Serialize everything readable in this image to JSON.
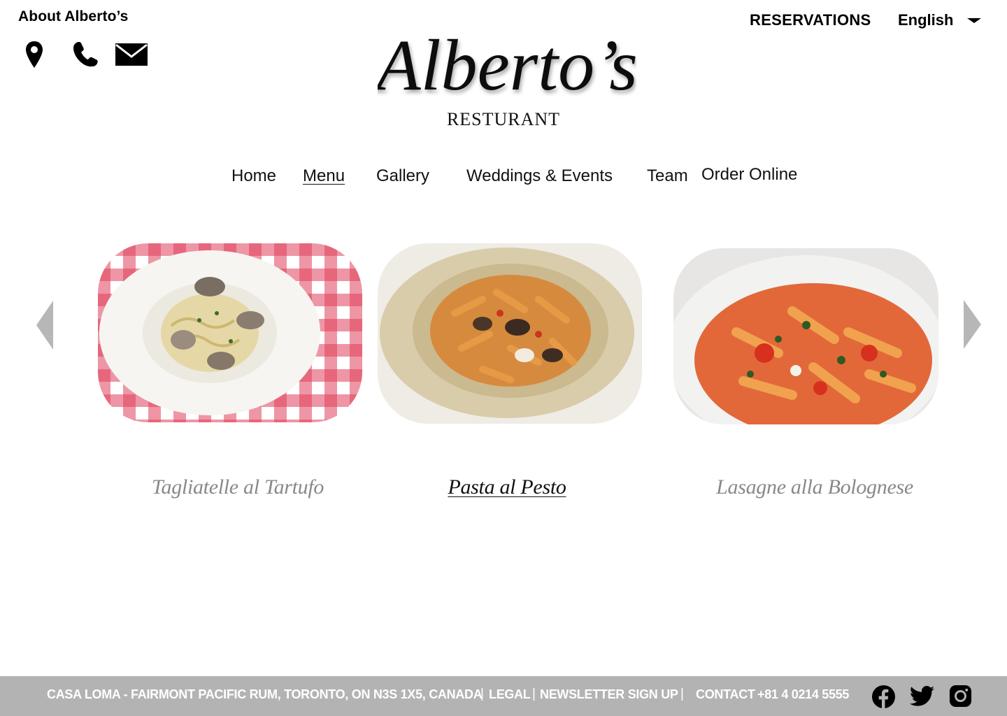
{
  "header": {
    "about_label": "About Alberto’s",
    "reservations_label": "RESERVATIONS",
    "language_label": "English",
    "logo_text": "Alberto’s",
    "logo_subtitle": "RESTURANT"
  },
  "contact_icons": [
    "location-pin-icon",
    "phone-icon",
    "email-icon"
  ],
  "nav": {
    "items": [
      {
        "label": "Home"
      },
      {
        "label": "Menu",
        "active": true
      },
      {
        "label": "Gallery"
      },
      {
        "label": "Weddings & Events"
      },
      {
        "label": "Team"
      },
      {
        "label": "Order Online"
      }
    ]
  },
  "carousel": {
    "dishes": [
      {
        "name": "Tagliatelle al Tartufo",
        "active": false
      },
      {
        "name": "Pasta al Pesto",
        "active": true
      },
      {
        "name": "Lasagne alla Bolognese",
        "active": false
      }
    ],
    "prev_icon": "chevron-left-icon",
    "next_icon": "chevron-right-icon"
  },
  "footer": {
    "address": "CASA LOMA - FAIRMONT PACIFIC RUM, TORONTO, ON N3S 1X5, CANADA",
    "legal": "LEGAL",
    "newsletter": "NEWSLETTER SIGN UP",
    "contact_label": "CONTACT",
    "phone": "+81 4 0214 5555",
    "separator": "|",
    "social": [
      "facebook-icon",
      "twitter-icon",
      "instagram-icon"
    ]
  },
  "colors": {
    "footer_bg": "#b3b3b3",
    "arrow": "#b7b7b7",
    "inactive_dish": "#888888",
    "text": "#111111"
  }
}
